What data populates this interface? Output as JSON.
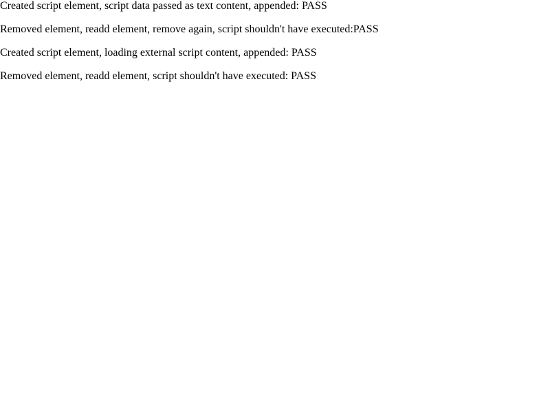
{
  "results": [
    {
      "text": "Created script element, script data passed as text content, appended: PASS"
    },
    {
      "text": "Removed element, readd element, remove again, script shouldn't have executed:PASS"
    },
    {
      "text": "Created script element, loading external script content, appended: PASS"
    },
    {
      "text": "Removed element, readd element, script shouldn't have executed: PASS"
    }
  ]
}
